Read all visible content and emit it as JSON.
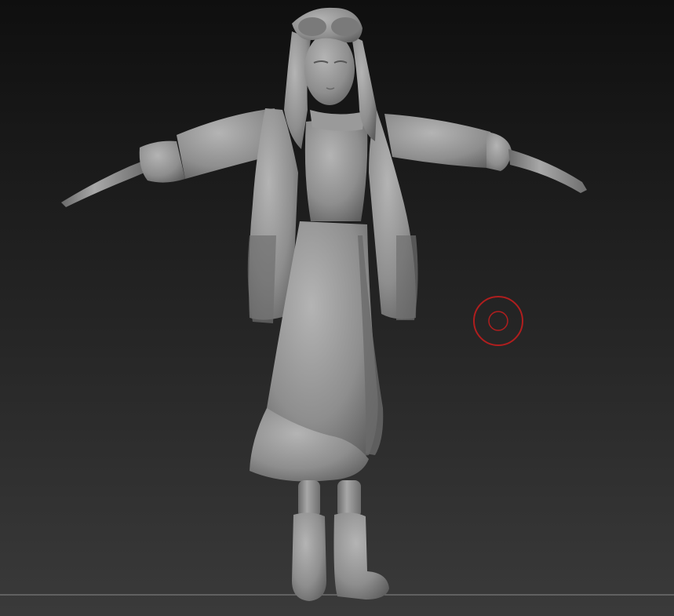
{
  "viewport": {
    "background_top": "#0e0e0e",
    "background_bottom": "#3b3b3b",
    "floor_line_color": "#8a8a8a"
  },
  "model": {
    "material_color": "#8c8c8c",
    "material_shadow": "#5a5a5a",
    "material_highlight": "#b6b6b6"
  },
  "brush_cursor": {
    "icon": "brush-cursor-icon",
    "color": "#b01e1e"
  }
}
